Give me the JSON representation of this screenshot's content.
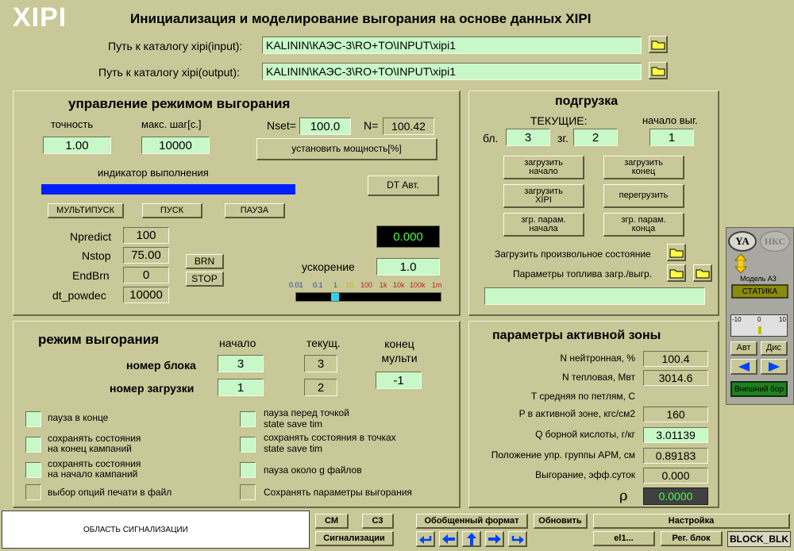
{
  "app": {
    "logo": "XIPI",
    "title": "Инициализация и моделирование выгорания на основе данных XIPI"
  },
  "paths": {
    "input_label": "Путь к каталогу xipi(input):",
    "input_value": "KALININ\\КАЭС-3\\RO+TO\\INPUT\\xipi1",
    "output_label": "Путь к каталогу xipi(output):",
    "output_value": "KALININ\\КАЭС-3\\RO+TO\\INPUT\\xipi1"
  },
  "burnup_control": {
    "title": "управление режимом выгорания",
    "accuracy_label": "точность",
    "accuracy_value": "1.00",
    "max_step_label": "макс. шаг[с.]",
    "max_step_value": "10000",
    "nset_label": "Nset=",
    "nset_value": "100.0",
    "n_label": "N=",
    "n_value": "100.42",
    "set_power_button": "установить мощность[%]",
    "progress_label": "индикатор выполнения",
    "progress": 1.0,
    "dt_auto_button": "DT Авт.",
    "multistart_button": "МУЛЬТИПУСК",
    "start_button": "ПУСК",
    "pause_button": "ПАУЗА",
    "npredict_label": "Npredict",
    "npredict_value": "100",
    "nstop_label": "Nstop",
    "nstop_value": "75.00",
    "endbrn_label": "EndBrn",
    "endbrn_value": "0",
    "dtpowdec_label": "dt_powdec",
    "dtpowdec_value": "10000",
    "brn_button": "BRN",
    "stop_button": "STOP",
    "display_value": "0.000",
    "accel_label": "ускорение",
    "accel_value": "1.0",
    "scale_ticks": [
      "0.01",
      "0.1",
      "1",
      "10",
      "100",
      "1k",
      "10k",
      "100k",
      "1m"
    ]
  },
  "reload": {
    "title": "подгрузка",
    "current_label": "ТЕКУЩИЕ:",
    "start_label": "начало выг.",
    "block_label": "бл.",
    "block_value": "3",
    "load_label": "зг.",
    "load_value": "2",
    "start_value": "1",
    "buttons": {
      "load_start": "загрузить начало",
      "load_end": "загрузить конец",
      "load_xipi": "загрузить XIPI",
      "reload": "перегрузить",
      "params_start": "згр. парам. начала",
      "params_end": "згр. парам. конца"
    },
    "arbitrary_label": "Загрузить произвольное состояние",
    "fuel_label": "Параметры топлива загр./выгр."
  },
  "side": {
    "ya": "YA",
    "nks": "НКС",
    "model_label": "Модель A3",
    "static_label": "СТАТИКА",
    "scale": [
      "-10",
      "0",
      "10"
    ],
    "avt": "Авт",
    "dis": "Дис",
    "external": "Внешний бор"
  },
  "mode": {
    "title": "режим выгорания",
    "start_col": "начало",
    "current_col": "текущ.",
    "end_multi": "конец мульти",
    "block_row": "номер блока",
    "block_start": "3",
    "block_current": "3",
    "load_row": "номер загрузки",
    "load_start": "1",
    "load_current": "2",
    "end_multi_value": "-1",
    "options": {
      "pause_end": "пауза в конце",
      "save_end_1": "сохранять состояния",
      "save_end_2": "на конец кампаний",
      "save_start_1": "сохранять состояния",
      "save_start_2": "на начало кампаний",
      "print_opts": "выбор опций печати в файл",
      "pause_point_1": "пауза перед точкой",
      "pause_point_2": "state  save  tim",
      "save_points_1": "сохранять состояния в точках",
      "save_points_2": "state  save  tim",
      "pause_g": "пауза около g файлов",
      "save_params": "Сохранять параметры выгорания"
    }
  },
  "core": {
    "title": "параметры активной зоны",
    "rows": [
      {
        "label": "N нейтронная, %",
        "value": "100.4"
      },
      {
        "label": "N тепловая, Мвт",
        "value": "3014.6"
      },
      {
        "label": "T средняя по петлям, С",
        "value": ""
      },
      {
        "label": "P в активной зоне, кгс/см2",
        "value": "160"
      },
      {
        "label": "Q борной кислоты, г/кг",
        "value": "3.01139"
      },
      {
        "label": "Положение упр. группы АРМ, см",
        "value": "0.89183"
      },
      {
        "label": "Выгорание, эфф.суток",
        "value": "0.000"
      }
    ],
    "rho_label": "ρ",
    "rho_value": "0.0000"
  },
  "bottom": {
    "signal_area": "ОБЛАСТЬ СИГНАЛИЗАЦИИ",
    "cm": "СМ",
    "c3": "С3",
    "signals": "Сигнализации",
    "generic_format": "Обобщенный формат",
    "refresh": "Обновить",
    "settings": "Настройка",
    "el1": "el1...",
    "reg_block": "Рег. блок",
    "block_blk": "BLOCK_BLK"
  },
  "colors": {
    "bg": "#c8c898",
    "field": "#c8f8c8",
    "progress": "#0020ff",
    "display_green": "#40ff40"
  }
}
